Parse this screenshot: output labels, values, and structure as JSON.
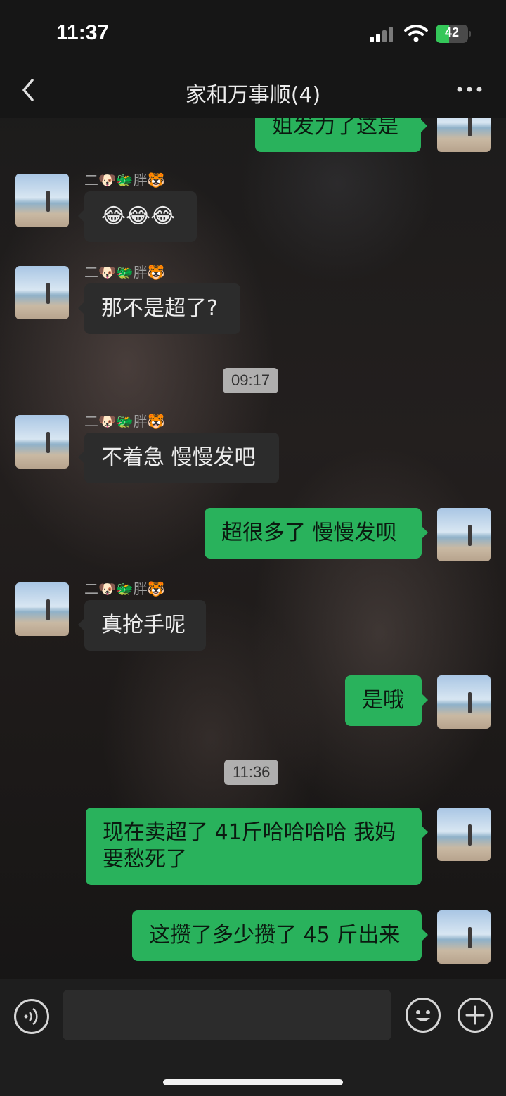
{
  "status_bar": {
    "time": "11:37",
    "battery_percent": "42",
    "battery_level": 0.42,
    "icons": [
      "signal-icon",
      "wifi-icon",
      "battery-icon"
    ]
  },
  "nav": {
    "title": "家和万事顺(4)",
    "back_icon": "chevron-left-icon",
    "more_icon": "more-dots-icon"
  },
  "colors": {
    "outgoing_bubble": "#29b25c",
    "incoming_bubble": "#2c2c2c",
    "background": "#141414"
  },
  "messages": [
    {
      "direction": "out",
      "text": "姐发力了这是"
    },
    {
      "direction": "in",
      "sender": "二🐶🐲胖🐯",
      "text": "😂😂😂"
    },
    {
      "direction": "in",
      "sender": "二🐶🐲胖🐯",
      "text": "那不是超了?"
    },
    {
      "type": "time",
      "text": "09:17"
    },
    {
      "direction": "in",
      "sender": "二🐶🐲胖🐯",
      "text": "不着急 慢慢发吧"
    },
    {
      "direction": "out",
      "text": "超很多了 慢慢发呗"
    },
    {
      "direction": "in",
      "sender": "二🐶🐲胖🐯",
      "text": "真抢手呢"
    },
    {
      "direction": "out",
      "text": "是哦"
    },
    {
      "type": "time",
      "text": "11:36"
    },
    {
      "direction": "out",
      "text": "现在卖超了 41斤哈哈哈哈 我妈要愁死了"
    },
    {
      "direction": "out",
      "text": "这攒了多少攒了 45 斤出来"
    }
  ],
  "input_bar": {
    "voice_icon": "voice-icon",
    "emoji_icon": "emoji-icon",
    "plus_icon": "plus-icon",
    "input_value": ""
  }
}
